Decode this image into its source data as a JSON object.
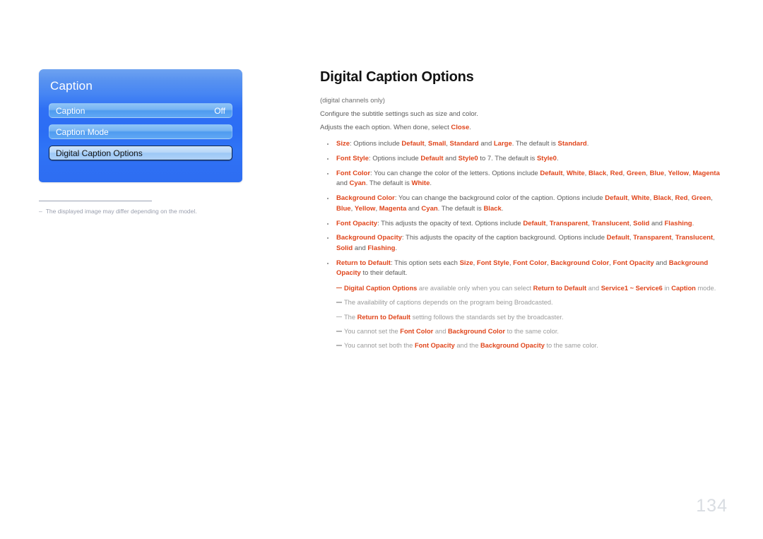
{
  "osd": {
    "title": "Caption",
    "rows": [
      {
        "label": "Caption",
        "value": "Off",
        "selected": false
      },
      {
        "label": "Caption Mode",
        "value": "",
        "selected": false
      },
      {
        "label": "Digital Caption Options",
        "value": "",
        "selected": true
      }
    ],
    "footnote_dash": "–",
    "footnote": "The displayed image may differ depending on the model."
  },
  "doc": {
    "title": "Digital Caption Options",
    "lede": [
      "(digital channels only)",
      "Configure the subtitle settings such as size and color."
    ],
    "lede_close_prefix": "Adjusts the each option. When done, select ",
    "lede_close_key": "Close",
    "lede_close_suffix": ".",
    "bullets": [
      {
        "key": "Size",
        "parts": [
          {
            "t": ": Options include ",
            "s": "n"
          },
          {
            "t": "Default",
            "s": "k"
          },
          {
            "t": ", ",
            "s": "n"
          },
          {
            "t": "Small",
            "s": "k"
          },
          {
            "t": ", ",
            "s": "n"
          },
          {
            "t": "Standard",
            "s": "k"
          },
          {
            "t": " and ",
            "s": "n"
          },
          {
            "t": "Large",
            "s": "k"
          },
          {
            "t": ". The default is ",
            "s": "n"
          },
          {
            "t": "Standard",
            "s": "k"
          },
          {
            "t": ".",
            "s": "n"
          }
        ]
      },
      {
        "key": "Font Style",
        "parts": [
          {
            "t": ": Options include ",
            "s": "n"
          },
          {
            "t": "Default",
            "s": "k"
          },
          {
            "t": " and ",
            "s": "n"
          },
          {
            "t": "Style0",
            "s": "k"
          },
          {
            "t": " to 7. The default is ",
            "s": "n"
          },
          {
            "t": "Style0",
            "s": "k"
          },
          {
            "t": ".",
            "s": "n"
          }
        ]
      },
      {
        "key": "Font Color",
        "parts": [
          {
            "t": ": You can change the color of the letters. Options include ",
            "s": "n"
          },
          {
            "t": "Default",
            "s": "k"
          },
          {
            "t": ", ",
            "s": "n"
          },
          {
            "t": "White",
            "s": "k"
          },
          {
            "t": ", ",
            "s": "n"
          },
          {
            "t": "Black",
            "s": "k"
          },
          {
            "t": ", ",
            "s": "n"
          },
          {
            "t": "Red",
            "s": "k"
          },
          {
            "t": ", ",
            "s": "n"
          },
          {
            "t": "Green",
            "s": "k"
          },
          {
            "t": ", ",
            "s": "n"
          },
          {
            "t": "Blue",
            "s": "k"
          },
          {
            "t": ", ",
            "s": "n"
          },
          {
            "t": "Yellow",
            "s": "k"
          },
          {
            "t": ", ",
            "s": "n"
          },
          {
            "t": "Magenta",
            "s": "k"
          },
          {
            "t": " and ",
            "s": "n"
          },
          {
            "t": "Cyan",
            "s": "k"
          },
          {
            "t": ". The default is ",
            "s": "n"
          },
          {
            "t": "White",
            "s": "k"
          },
          {
            "t": ".",
            "s": "n"
          }
        ]
      },
      {
        "key": "Background Color",
        "parts": [
          {
            "t": ": You can change the background color of the caption. Options include ",
            "s": "n"
          },
          {
            "t": "Default",
            "s": "k"
          },
          {
            "t": ", ",
            "s": "n"
          },
          {
            "t": "White",
            "s": "k"
          },
          {
            "t": ", ",
            "s": "n"
          },
          {
            "t": "Black",
            "s": "k"
          },
          {
            "t": ", ",
            "s": "n"
          },
          {
            "t": "Red",
            "s": "k"
          },
          {
            "t": ", ",
            "s": "n"
          },
          {
            "t": "Green",
            "s": "k"
          },
          {
            "t": ", ",
            "s": "n"
          },
          {
            "t": "Blue",
            "s": "k"
          },
          {
            "t": ", ",
            "s": "n"
          },
          {
            "t": "Yellow",
            "s": "k"
          },
          {
            "t": ", ",
            "s": "n"
          },
          {
            "t": "Magenta",
            "s": "k"
          },
          {
            "t": " and ",
            "s": "n"
          },
          {
            "t": "Cyan",
            "s": "k"
          },
          {
            "t": ". The default is ",
            "s": "n"
          },
          {
            "t": "Black",
            "s": "k"
          },
          {
            "t": ".",
            "s": "n"
          }
        ]
      },
      {
        "key": "Font Opacity",
        "parts": [
          {
            "t": ": This adjusts the opacity of text. Options include ",
            "s": "n"
          },
          {
            "t": "Default",
            "s": "k"
          },
          {
            "t": ", ",
            "s": "n"
          },
          {
            "t": "Transparent",
            "s": "k"
          },
          {
            "t": ", ",
            "s": "n"
          },
          {
            "t": "Translucent",
            "s": "k"
          },
          {
            "t": ", ",
            "s": "n"
          },
          {
            "t": "Solid",
            "s": "k"
          },
          {
            "t": " and ",
            "s": "n"
          },
          {
            "t": "Flashing",
            "s": "k"
          },
          {
            "t": ".",
            "s": "n"
          }
        ]
      },
      {
        "key": "Background Opacity",
        "parts": [
          {
            "t": ": This adjusts the opacity of the caption background. Options include ",
            "s": "n"
          },
          {
            "t": "Default",
            "s": "k"
          },
          {
            "t": ", ",
            "s": "n"
          },
          {
            "t": "Transparent",
            "s": "k"
          },
          {
            "t": ", ",
            "s": "n"
          },
          {
            "t": "Translucent",
            "s": "k"
          },
          {
            "t": ", ",
            "s": "n"
          },
          {
            "t": "Solid",
            "s": "k"
          },
          {
            "t": " and ",
            "s": "n"
          },
          {
            "t": "Flashing",
            "s": "k"
          },
          {
            "t": ".",
            "s": "n"
          }
        ]
      },
      {
        "key": "Return to Default",
        "parts": [
          {
            "t": ": This option sets each ",
            "s": "n"
          },
          {
            "t": "Size",
            "s": "k"
          },
          {
            "t": ", ",
            "s": "n"
          },
          {
            "t": "Font Style",
            "s": "k"
          },
          {
            "t": ", ",
            "s": "n"
          },
          {
            "t": "Font Color",
            "s": "k"
          },
          {
            "t": ", ",
            "s": "n"
          },
          {
            "t": "Background Color",
            "s": "k"
          },
          {
            "t": ", ",
            "s": "n"
          },
          {
            "t": "Font Opacity",
            "s": "k"
          },
          {
            "t": " and ",
            "s": "n"
          },
          {
            "t": "Background Opacity",
            "s": "k"
          },
          {
            "t": " to their default.",
            "s": "n"
          }
        ]
      }
    ],
    "notes": [
      {
        "muted": false,
        "parts": [
          {
            "t": "Digital Caption Options",
            "s": "k"
          },
          {
            "t": " are available only when you can select ",
            "s": "n"
          },
          {
            "t": "Return to Default",
            "s": "k"
          },
          {
            "t": " and ",
            "s": "n"
          },
          {
            "t": "Service1 ~ Service6",
            "s": "k"
          },
          {
            "t": " in ",
            "s": "n"
          },
          {
            "t": "Caption",
            "s": "k"
          },
          {
            "t": " mode.",
            "s": "n"
          }
        ]
      },
      {
        "muted": true,
        "parts": [
          {
            "t": "The availability of captions depends on the program being Broadcasted.",
            "s": "n"
          }
        ]
      },
      {
        "muted": true,
        "parts": [
          {
            "t": "The ",
            "s": "n"
          },
          {
            "t": "Return to Default",
            "s": "k"
          },
          {
            "t": " setting follows the standards set by the broadcaster.",
            "s": "n"
          }
        ]
      },
      {
        "muted": true,
        "parts": [
          {
            "t": "You cannot set the ",
            "s": "n"
          },
          {
            "t": "Font Color",
            "s": "k"
          },
          {
            "t": " and ",
            "s": "n"
          },
          {
            "t": "Background Color",
            "s": "k"
          },
          {
            "t": " to the same color.",
            "s": "n"
          }
        ]
      },
      {
        "muted": true,
        "parts": [
          {
            "t": "You cannot set both the ",
            "s": "n"
          },
          {
            "t": "Font Opacity",
            "s": "k"
          },
          {
            "t": " and the ",
            "s": "n"
          },
          {
            "t": "Background Opacity",
            "s": "k"
          },
          {
            "t": " to the same color.",
            "s": "n"
          }
        ]
      }
    ],
    "page_number": "134"
  },
  "colors": {
    "accent": "#e0451b",
    "osd_blue": "#2f6ff3",
    "page_number": "#d9dde2"
  }
}
